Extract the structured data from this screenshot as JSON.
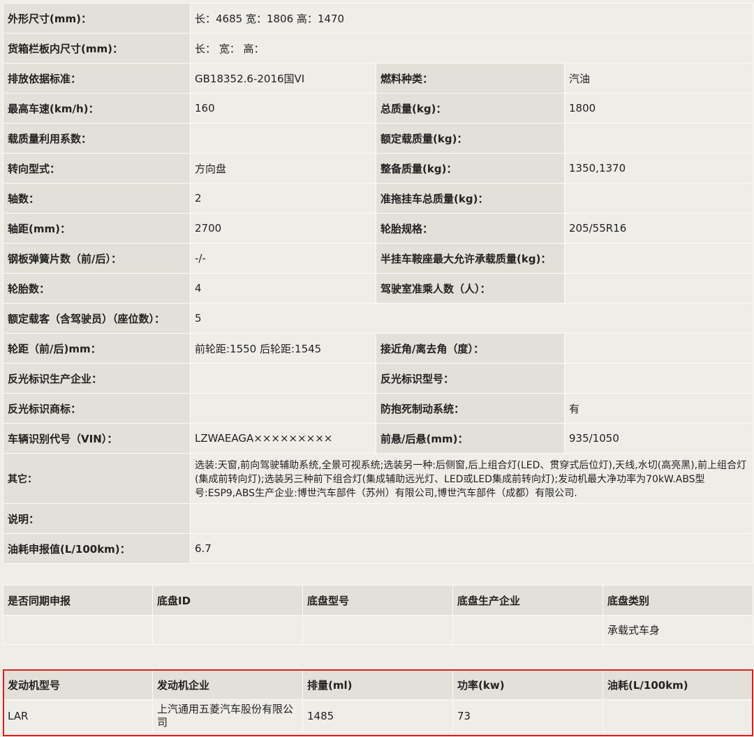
{
  "spec_rows": [
    {
      "label": "外形尺寸(mm)：",
      "value": "长：4685 宽：1806 高：1470"
    },
    {
      "label": "货箱栏板内尺寸(mm)：",
      "value": "长：  宽：  高："
    },
    {
      "label": "排放依据标准：",
      "value": "GB18352.6-2016国VI",
      "label2": "燃料种类：",
      "value2": "汽油"
    },
    {
      "label": "最高车速(km/h)：",
      "value": "160",
      "label2": "总质量(kg)：",
      "value2": "1800"
    },
    {
      "label": "载质量利用系数：",
      "value": "",
      "label2": "额定载质量(kg)：",
      "value2": ""
    },
    {
      "label": "转向型式：",
      "value": "方向盘",
      "label2": "整备质量(kg)：",
      "value2": "1350,1370"
    },
    {
      "label": "轴数：",
      "value": "2",
      "label2": "准拖挂车总质量(kg)：",
      "value2": ""
    },
    {
      "label": "轴距(mm)：",
      "value": "2700",
      "label2": "轮胎规格：",
      "value2": "205/55R16"
    },
    {
      "label": "钢板弹簧片数（前/后）：",
      "value": "-/-",
      "label2": "半挂车鞍座最大允许承载质量(kg)：",
      "value2": ""
    },
    {
      "label": "轮胎数：",
      "value": "4",
      "label2": "驾驶室准乘人数（人）：",
      "value2": ""
    },
    {
      "label": "额定载客（含驾驶员）（座位数）：",
      "value": "5"
    },
    {
      "label": "轮距（前/后)mm：",
      "value": "前轮距:1550 后轮距:1545",
      "label2": "接近角/离去角（度）：",
      "value2": ""
    },
    {
      "label": "反光标识生产企业：",
      "value": "",
      "label2": "反光标识型号：",
      "value2": ""
    },
    {
      "label": "反光标识商标：",
      "value": "",
      "label2": "防抱死制动系统：",
      "value2": "有"
    },
    {
      "label": "车辆识别代号（VIN）：",
      "value": "LZWAEAGA×××××××××",
      "label2": "前悬/后悬(mm)：",
      "value2": "935/1050"
    },
    {
      "label": "其它：",
      "value": "选装:天窗,前向驾驶辅助系统,全景可视系统;选装另一种:后侧窗,后上组合灯(LED、贯穿式后位灯),天线,水切(高亮黑),前上组合灯(集成前转向灯);选装另三种前下组合灯(集成辅助远光灯、LED或LED集成前转向灯);发动机最大净功率为70kW.ABS型号:ESP9,ABS生产企业:博世汽车部件（苏州）有限公司,博世汽车部件（成都）有限公司."
    },
    {
      "label": "说明：",
      "value": ""
    },
    {
      "label": "油耗申报值(L/100km)：",
      "value": "6.7"
    }
  ],
  "chassis": {
    "headers": [
      "是否同期申报",
      "底盘ID",
      "底盘型号",
      "底盘生产企业",
      "底盘类别"
    ],
    "row": [
      "",
      "",
      "",
      "",
      "承载式车身"
    ]
  },
  "engine": {
    "headers": [
      "发动机型号",
      "发动机企业",
      "排量(ml)",
      "功率(kw)",
      "油耗(L/100km)"
    ],
    "row": [
      "LAR",
      "上汽通用五菱汽车股份有限公司",
      "1485",
      "73",
      ""
    ]
  },
  "highlight_color": "#d62020"
}
